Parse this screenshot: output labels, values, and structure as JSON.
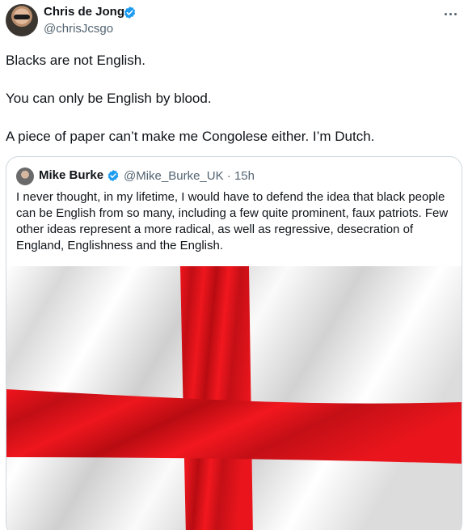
{
  "author": {
    "name": "Chris de Jong",
    "handle": "@chrisJcsgo",
    "verified": true
  },
  "tweet": {
    "paragraphs": [
      "Blacks are not English.",
      "You can only be English by blood.",
      "A piece of paper can’t make me Congolese either. I’m Dutch."
    ]
  },
  "quote": {
    "author_name": "Mike Burke",
    "author_handle": "@Mike_Burke_UK",
    "separator": "·",
    "time": "15h",
    "text": "I never thought, in my lifetime, I would have to defend the idea that black people can be English from so many, including a few quite prominent, faux patriots. Few other ideas represent a more radical, as well as regressive, desecration of England, Englishness and the English.",
    "image": "england-flag"
  },
  "colors": {
    "text": "#0f1419",
    "secondary": "#536471",
    "verified": "#1d9bf0",
    "border": "#cfd9de",
    "flag_red": "#e3151c",
    "flag_white": "#f4f4f4"
  },
  "icons": {
    "verified": "verified-badge-icon",
    "more": "more-dots-icon"
  }
}
